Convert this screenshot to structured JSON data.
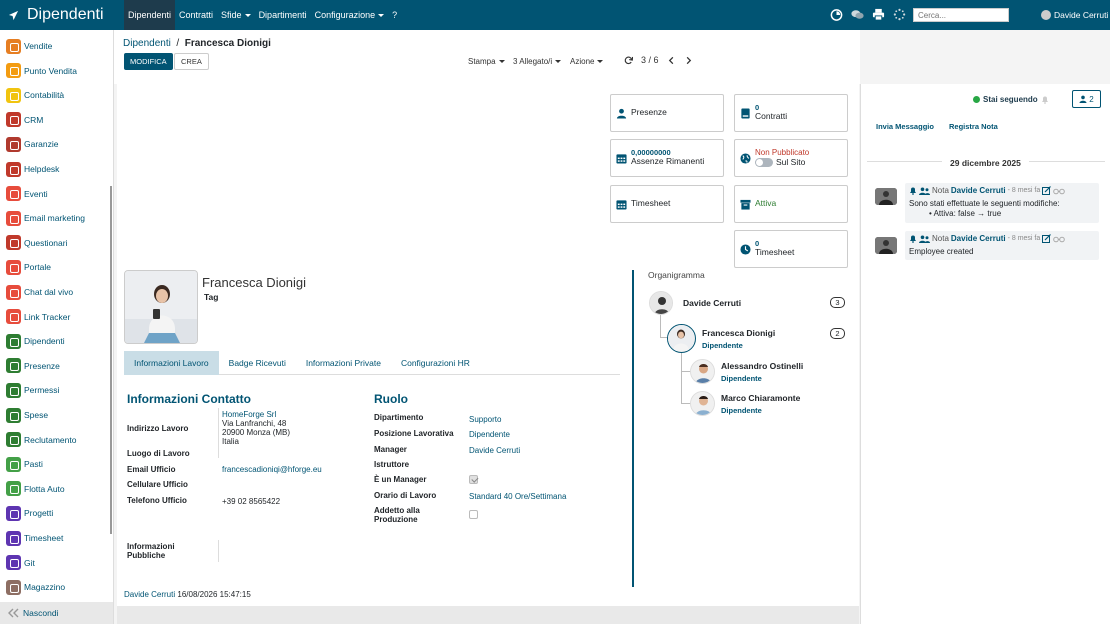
{
  "app": {
    "title": "Dipendenti"
  },
  "topmenu": {
    "items": [
      {
        "label": "Dipendenti",
        "caret": false
      },
      {
        "label": "Contratti",
        "caret": false
      },
      {
        "label": "Sfide",
        "caret": true
      },
      {
        "label": "Dipartimenti",
        "caret": false
      },
      {
        "label": "Configurazione",
        "caret": true
      },
      {
        "label": "?",
        "caret": false
      }
    ],
    "search_placeholder": "Cerca...",
    "user": "Davide Cerruti"
  },
  "sidebar": {
    "items": [
      {
        "label": "Vendite",
        "color": "#e67e22"
      },
      {
        "label": "Punto Vendita",
        "color": "#f39c12"
      },
      {
        "label": "Contabilità",
        "color": "#f1c40f"
      },
      {
        "label": "CRM",
        "color": "#c0392b"
      },
      {
        "label": "Garanzie",
        "color": "#b03a2e"
      },
      {
        "label": "Helpdesk",
        "color": "#c0392b"
      },
      {
        "label": "Eventi",
        "color": "#e74c3c"
      },
      {
        "label": "Email marketing",
        "color": "#e74c3c"
      },
      {
        "label": "Questionari",
        "color": "#c0392b"
      },
      {
        "label": "Portale",
        "color": "#e74c3c"
      },
      {
        "label": "Chat dal vivo",
        "color": "#e74c3c"
      },
      {
        "label": "Link Tracker",
        "color": "#e74c3c"
      },
      {
        "label": "Dipendenti",
        "color": "#2e7d32"
      },
      {
        "label": "Presenze",
        "color": "#2e7d32"
      },
      {
        "label": "Permessi",
        "color": "#2e7d32"
      },
      {
        "label": "Spese",
        "color": "#2e7d32"
      },
      {
        "label": "Reclutamento",
        "color": "#2e7d32"
      },
      {
        "label": "Pasti",
        "color": "#43a047"
      },
      {
        "label": "Flotta Auto",
        "color": "#43a047"
      },
      {
        "label": "Progetti",
        "color": "#5e35b1"
      },
      {
        "label": "Timesheet",
        "color": "#5e35b1"
      },
      {
        "label": "Git",
        "color": "#5e35b1"
      },
      {
        "label": "Magazzino",
        "color": "#8d6e63"
      }
    ],
    "hide_label": "Nascondi"
  },
  "control": {
    "breadcrumb_parent": "Dipendenti",
    "breadcrumb_current": "Francesca Dionigi",
    "edit_label": "MODIFICA",
    "create_label": "CREA",
    "print_label": "Stampa",
    "attach_label": "3 Allegato/i",
    "action_label": "Azione",
    "pager": "3 / 6"
  },
  "smart_buttons": {
    "presenze": {
      "title": "Presenze"
    },
    "contratti": {
      "value": "0",
      "title": "Contratti"
    },
    "assenze": {
      "value": "0,00000000",
      "title": "Assenze Rimanenti"
    },
    "pubblicato": {
      "value": "Non Pubblicato",
      "title": "Sul Sito"
    },
    "timesheet1": {
      "title": "Timesheet"
    },
    "attiva": {
      "title": "Attiva"
    },
    "timesheet2": {
      "value": "0",
      "title": "Timesheet"
    }
  },
  "employee": {
    "name": "Francesca Dionigi",
    "tag": "Tag"
  },
  "tabs": [
    "Informazioni Lavoro",
    "Badge Ricevuti",
    "Informazioni Private",
    "Configurazioni HR"
  ],
  "contact": {
    "title": "Informazioni Contatto",
    "work_address_label": "Indirizzo Lavoro",
    "address_lines": [
      "HomeForge Srl",
      "Via Lanfranchi, 48",
      "20900 Monza (MB)",
      "Italia"
    ],
    "work_location_label": "Luogo di Lavoro",
    "email_label": "Email Ufficio",
    "email_value": "francescadioniqi@hforge.eu",
    "mobile_label": "Cellulare Ufficio",
    "phone_label": "Telefono Ufficio",
    "phone_value": "+39 02 8565422",
    "public_info_label": "Informazioni Pubbliche"
  },
  "role": {
    "title": "Ruolo",
    "department_label": "Dipartimento",
    "department_value": "Supporto",
    "position_label": "Posizione Lavorativa",
    "position_value": "Dipendente",
    "manager_label": "Manager",
    "manager_value": "Davide Cerruti",
    "coach_label": "Istruttore",
    "is_manager_label": "È un Manager",
    "is_manager": true,
    "schedule_label": "Orario di Lavoro",
    "schedule_value": "Standard 40 Ore/Settimana",
    "production_label": "Addetto alla Produzione",
    "production": false
  },
  "footer": {
    "user": "Davide Cerruti",
    "date": "16/08/2026 15:47:15"
  },
  "org": {
    "title": "Organigramma",
    "manager": {
      "name": "Davide Cerruti",
      "count": "3"
    },
    "self": {
      "name": "Francesca Dionigi",
      "role": "Dipendente",
      "count": "2"
    },
    "reports": [
      {
        "name": "Alessandro Ostinelli",
        "role": "Dipendente"
      },
      {
        "name": "Marco Chiaramonte",
        "role": "Dipendente"
      }
    ]
  },
  "chatter": {
    "following": "Stai seguendo",
    "followers_count": "2",
    "send_message": "Invia Messaggio",
    "log_note": "Registra Nota",
    "date": "29 dicembre 2025",
    "messages": [
      {
        "type": "Nota",
        "author": "Davide Cerruti",
        "when": "- 8 mesi fa",
        "line1": "Sono stati effettuate le seguenti modifiche:",
        "line2": "• Attiva: false → true"
      },
      {
        "type": "Nota",
        "author": "Davide Cerruti",
        "when": "- 8 mesi fa",
        "line1": "Employee created",
        "line2": ""
      }
    ]
  },
  "colors": {
    "primary": "#015473",
    "topbar": "#015473",
    "active_menu": "#1e3b4c"
  }
}
